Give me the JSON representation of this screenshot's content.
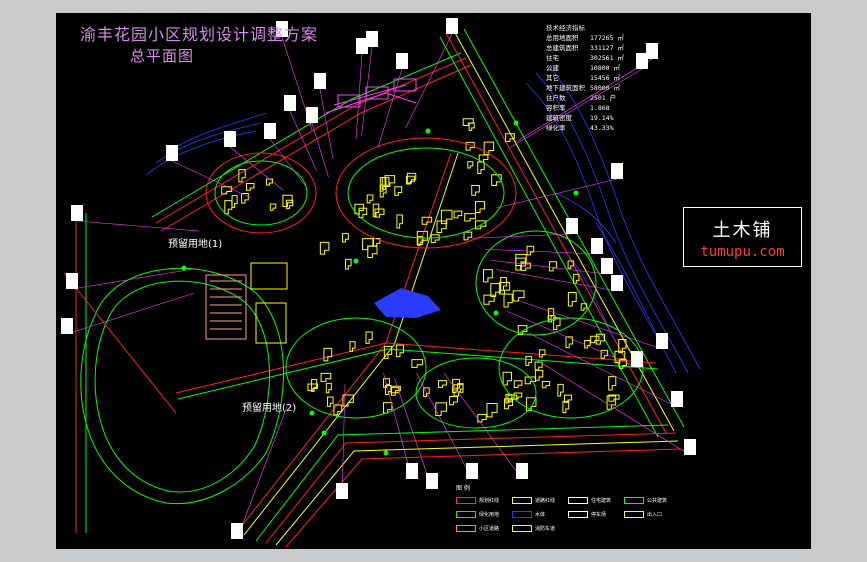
{
  "drawing": {
    "title_line1": "渝丰花园小区规划设计调整方案",
    "title_line2": "总平面图",
    "reserve_label_1": "预留用地(1)",
    "reserve_label_2": "预留用地(2)"
  },
  "stats": {
    "header": "技术经济指标",
    "rows": [
      {
        "key": "总用地面积",
        "value": "177265 ㎡"
      },
      {
        "key": "总建筑面积",
        "value": "331127 ㎡"
      },
      {
        "key": "住宅",
        "value": "302561 ㎡"
      },
      {
        "key": "公建",
        "value": "10800 ㎡"
      },
      {
        "key": "其它",
        "value": "15456 ㎡"
      },
      {
        "key": "地下建筑面积",
        "value": "58000 ㎡"
      },
      {
        "key": "住户数",
        "value": "2501 户"
      },
      {
        "key": "容积率",
        "value": "1.868"
      },
      {
        "key": "建筑密度",
        "value": "19.14%"
      },
      {
        "key": "绿化率",
        "value": "43.33%"
      }
    ]
  },
  "legend": {
    "title": "图 例",
    "items": [
      {
        "label": "规划红线",
        "color": "#ff3030"
      },
      {
        "label": "道路红线",
        "color": "#ffff00"
      },
      {
        "label": "住宅建筑",
        "color": "#ffffff"
      },
      {
        "label": "公共建筑",
        "color": "#00ff00"
      },
      {
        "label": "绿化用地",
        "color": "#00ff00"
      },
      {
        "label": "水体",
        "color": "#2040ff"
      },
      {
        "label": "停车场",
        "color": "#ffffff"
      },
      {
        "label": "出入口",
        "color": "#ffff00"
      },
      {
        "label": "小区道路",
        "color": "#ff9a00"
      },
      {
        "label": "消防车道",
        "color": "#ffff00"
      }
    ]
  },
  "watermark": {
    "brand": "土木铺",
    "url": "tumupu.com",
    "url_color": "#ff3b3b"
  },
  "colors": {
    "background": "#000000",
    "frame": "#c9cbcc",
    "title": "#d58be6",
    "road_red": "#ff2020",
    "road_yellow": "#ffff00",
    "green": "#00ff00",
    "blue": "#2a3cff",
    "cyan": "#00ffff"
  }
}
